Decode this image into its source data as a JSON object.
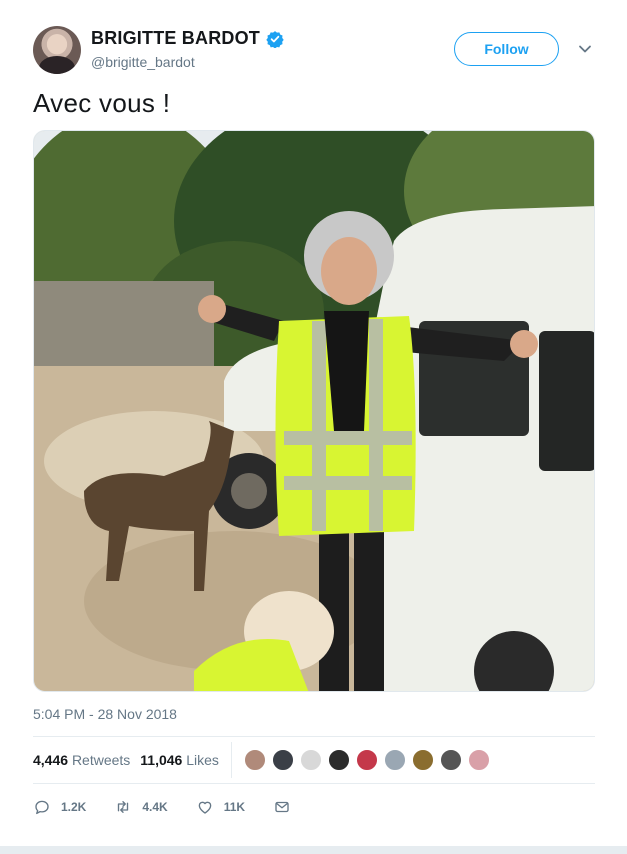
{
  "author": {
    "display_name": "BRIGITTE BARDOT",
    "handle": "@brigitte_bardot",
    "verified": true
  },
  "follow_button": {
    "label": "Follow"
  },
  "tweet": {
    "text": "Avec vous !",
    "timestamp": "5:04 PM - 28 Nov 2018"
  },
  "stats": {
    "retweets_count": "4,446",
    "retweets_label": "Retweets",
    "likes_count": "11,046",
    "likes_label": "Likes"
  },
  "likers": [
    {
      "color": "#b08a7a"
    },
    {
      "color": "#3a3f47"
    },
    {
      "color": "#d8d8d8"
    },
    {
      "color": "#2b2b2b"
    },
    {
      "color": "#c4384a"
    },
    {
      "color": "#9aa7b3"
    },
    {
      "color": "#8a6d2f"
    },
    {
      "color": "#555555"
    },
    {
      "color": "#d9a0a8"
    }
  ],
  "actions": {
    "reply_count": "1.2K",
    "retweet_count": "4.4K",
    "like_count": "11K"
  },
  "colors": {
    "accent": "#1da1f2",
    "secondary_text": "#657786",
    "vest": "#d8f532"
  },
  "icons": [
    "verified-badge-icon",
    "chevron-down-icon",
    "reply-icon",
    "retweet-icon",
    "heart-icon",
    "message-icon"
  ]
}
